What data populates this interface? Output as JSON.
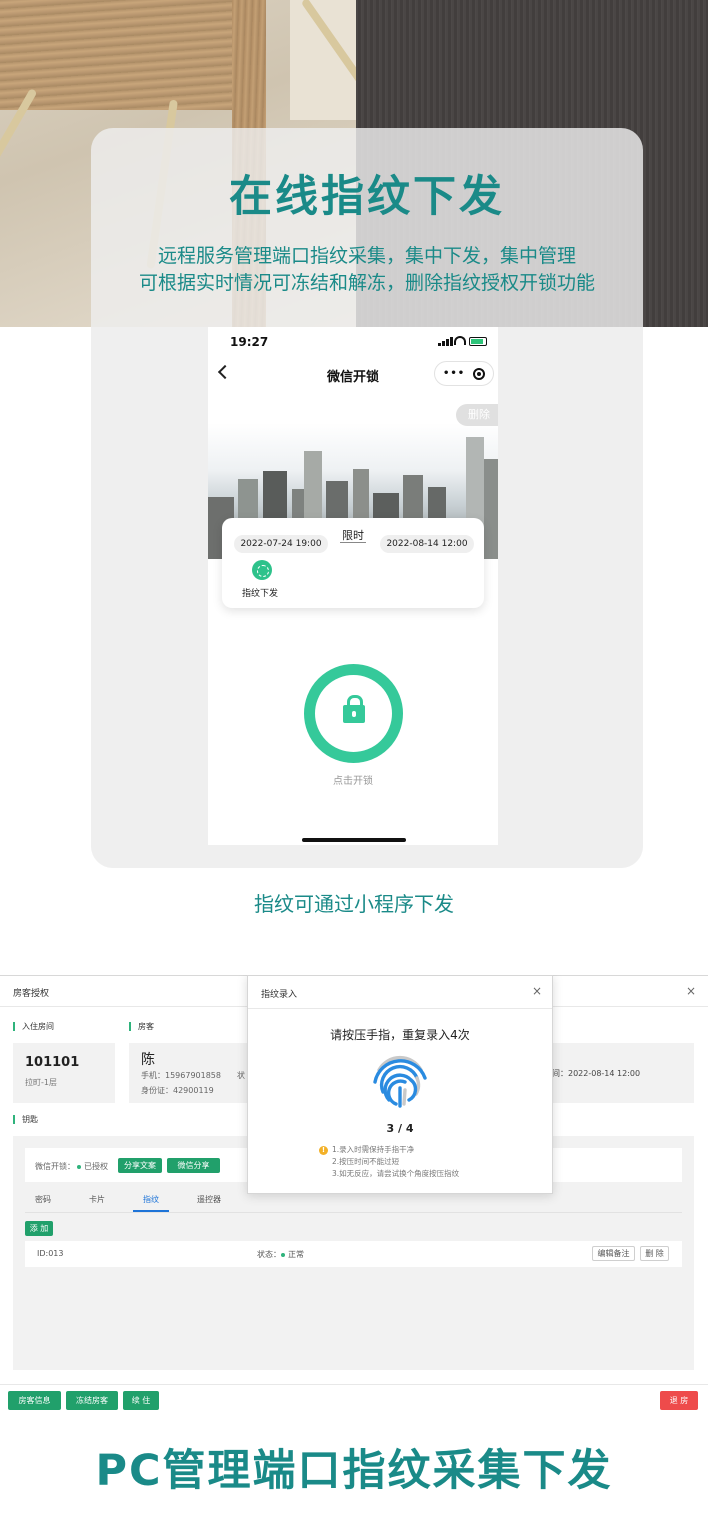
{
  "hero": {
    "title": "在线指纹下发",
    "subtitle_line1": "远程服务管理端口指纹采集，集中下发，集中管理",
    "subtitle_line2": "可根据实时情况可冻结和解冻，删除指纹授权开锁功能"
  },
  "phone": {
    "status_time": "19:27",
    "nav_title": "微信开锁",
    "more_glyph": "•••",
    "delete_label": "删除",
    "limit_label": "限时",
    "start_date": "2022-07-24 19:00",
    "end_date": "2022-08-14 12:00",
    "fingerprint_issue_label": "指纹下发",
    "unlock_label": "点击开锁"
  },
  "caption1": "指纹可通过小程序下发",
  "pc": {
    "panel_title": "房客授权",
    "close_glyph": "×",
    "section_room": "入住房间",
    "section_guest": "房客",
    "section_keys": "钥匙",
    "room_number": "101101",
    "room_floor": "拉町-1层",
    "guest_name": "陈",
    "guest_phone": "手机：15967901858",
    "guest_status_prefix": "状",
    "guest_id": "身份证：42900119",
    "guest_time": "间：2022-08-14 12:00",
    "wechat_unlock_label": "微信开锁：",
    "wechat_status": "已授权",
    "share_text_btn": "分享文案",
    "wechat_share_btn": "微信分享",
    "tabs": [
      "密码",
      "卡片",
      "指纹",
      "遥控器"
    ],
    "add_btn": "添 加",
    "fingerprint_id": "ID:013",
    "fingerprint_state_label": "状态：",
    "fingerprint_state": "正常",
    "edit_note_btn": "编辑备注",
    "delete_btn": "删 除",
    "bottom_buttons": [
      "房客信息",
      "冻结房客",
      "续 住"
    ],
    "checkout_btn": "退 房"
  },
  "modal": {
    "title": "指纹录入",
    "close_glyph": "×",
    "prompt": "请按压手指，重复录入4次",
    "progress": "3 / 4",
    "warn_glyph": "!",
    "tips": [
      "1.录入时需保持手指干净",
      "2.按压时间不能过短",
      "3.如无反应，请尝试换个角度按压指纹"
    ]
  },
  "caption2": "PC管理端口指纹采集下发",
  "colors": {
    "accent_teal": "#1a8a88",
    "green": "#21a06b",
    "ring_green": "#35c99a",
    "red": "#ee4b4b",
    "tab_blue": "#1e74d8"
  }
}
